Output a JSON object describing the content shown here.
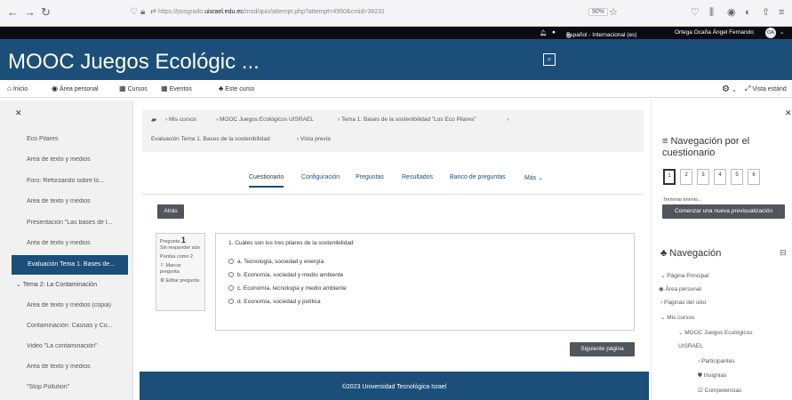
{
  "browser": {
    "url_prefix": "https://posgrado.",
    "url_domain": "uisrael.edu.ec",
    "url_path": "/mod/quiz/attempt.php?attempt=4950&cmid=39231",
    "zoom": "90%"
  },
  "topbar": {
    "language": "Español - Internacional (es)",
    "user_name": "Ortega Ocaña Ángel Fernando",
    "avatar_initials": "OA"
  },
  "header": {
    "title": "MOOC Juegos Ecológic ..."
  },
  "navbar": {
    "items": [
      {
        "label": "Inicio",
        "icon": "home-icon"
      },
      {
        "label": "Área personal",
        "icon": "dashboard-icon"
      },
      {
        "label": "Cursos",
        "icon": "courses-icon"
      },
      {
        "label": "Eventos",
        "icon": "calendar-icon"
      },
      {
        "label": "Este curso",
        "icon": "sitemap-icon"
      }
    ],
    "vista": "Vista estánd"
  },
  "left_drawer": {
    "items": [
      {
        "label": "Eco Pilares"
      },
      {
        "label": "Área de texto y medios"
      },
      {
        "label": "Foro: Reforzando sobre lo..."
      },
      {
        "label": "Área de texto y medios"
      },
      {
        "label": "Presentación \"Las bases de l..."
      },
      {
        "label": "Área de texto y medios"
      },
      {
        "label": "Evaluación Tema 1. Bases de..."
      },
      {
        "label": "Tema 2: La Contaminación"
      },
      {
        "label": "Área de texto y medios (copia)"
      },
      {
        "label": "Contaminación: Causas y Co..."
      },
      {
        "label": "Video \"La contaminación\""
      },
      {
        "label": "Área de texto y medios"
      },
      {
        "label": "\"Stop Pollution\""
      }
    ]
  },
  "breadcrumb": {
    "items": [
      "Mis cursos",
      "MOOC Juegos Ecológicos UISRAEL",
      "Tema 1. Bases de la sostenibilidad \"Los Eco Pilares\""
    ],
    "line2_a": "Evaluación Tema 1. Bases de la sostenibilidad",
    "line2_b": "Vista previa"
  },
  "tabs": {
    "items": [
      "Cuestionario",
      "Configuración",
      "Preguntas",
      "Resultados",
      "Banco de preguntas",
      "Más"
    ]
  },
  "main": {
    "back_button": "Atrás",
    "question_label": "Pregunta",
    "question_number": "1",
    "question_status": "Sin responder aún",
    "question_score": "Puntúa como 2",
    "flag_label": "Marcar pregunta",
    "edit_label": "Editar pregunta",
    "question_text": "1. Cuáles son los tres pilares de la sostenibilidad",
    "options": [
      {
        "letter": "a.",
        "text": "Tecnología, sociedad y energía"
      },
      {
        "letter": "b.",
        "text": "Economía, sociedad y medio ambiente"
      },
      {
        "letter": "c.",
        "text": "Economía, tecnología y medio ambiente"
      },
      {
        "letter": "d.",
        "text": "Economía, sociedad y política"
      }
    ],
    "next_button": "Siguiente página"
  },
  "footer": {
    "text": "©2023 Universidad Tecnológica Israel"
  },
  "quiz_nav": {
    "title": "Navegación por el cuestionario",
    "pages": [
      "1",
      "2",
      "3",
      "4",
      "5",
      "6"
    ],
    "finish_link": "Terminar intento...",
    "new_preview_button": "Comenzar una nueva previsualización"
  },
  "navigation": {
    "title": "Navegación",
    "items": [
      "Página Principal",
      "Área personal",
      "Páginas del sitio",
      "Mis cursos",
      "MOOC Juegos Ecológicos",
      "UISRAEL",
      "Participantes",
      "Insignias",
      "Competencias"
    ]
  },
  "colors": {
    "brand": "#1b4f7a",
    "topbar": "#0b0b14",
    "button": "#50565c"
  }
}
